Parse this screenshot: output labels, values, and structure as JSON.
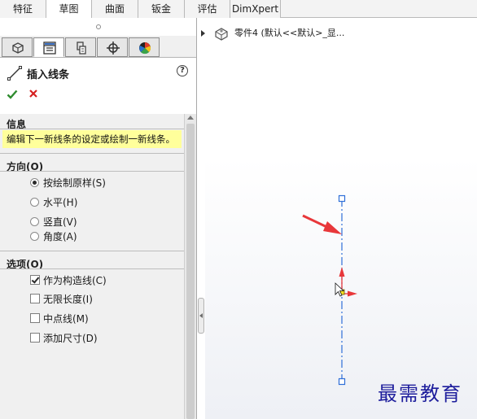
{
  "tabs": [
    {
      "label": "特征",
      "active": false
    },
    {
      "label": "草图",
      "active": true
    },
    {
      "label": "曲面",
      "active": false
    },
    {
      "label": "钣金",
      "active": false
    },
    {
      "label": "评估",
      "active": false
    },
    {
      "label": "DimXpert",
      "active": false
    }
  ],
  "feature_manager_tabs": [
    {
      "icon": "feature-tree-icon",
      "active": false
    },
    {
      "icon": "property-manager-icon",
      "active": true
    },
    {
      "icon": "configuration-manager-icon",
      "active": false
    },
    {
      "icon": "dimxpert-manager-icon",
      "active": false
    },
    {
      "icon": "display-manager-icon",
      "active": false
    }
  ],
  "property_manager": {
    "title": "插入线条",
    "help": "?",
    "info": {
      "heading": "信息",
      "message": "编辑下一新线条的设定或绘制一新线条。"
    },
    "orientation": {
      "heading": "方向(O)",
      "options": [
        {
          "label": "按绘制原样(S)",
          "selected": true
        },
        {
          "label": "水平(H)",
          "selected": false
        },
        {
          "label": "竖直(V)",
          "selected": false
        },
        {
          "label": "角度(A)",
          "selected": false
        }
      ]
    },
    "options": {
      "heading": "选项(O)",
      "items": [
        {
          "label": "作为构造线(C)",
          "checked": true
        },
        {
          "label": "无限长度(I)",
          "checked": false
        },
        {
          "label": "中点线(M)",
          "checked": false
        },
        {
          "label": "添加尺寸(D)",
          "checked": false
        }
      ]
    }
  },
  "graphics": {
    "tree_label": "零件4  (默认<<默认>_显..."
  },
  "watermark": "最需教育",
  "colors": {
    "info_highlight": "#ffff9b",
    "construction_line": "#2f6fd8",
    "arrow": "#e8373a",
    "ok": "#2e8b2e",
    "cancel": "#d62020"
  }
}
